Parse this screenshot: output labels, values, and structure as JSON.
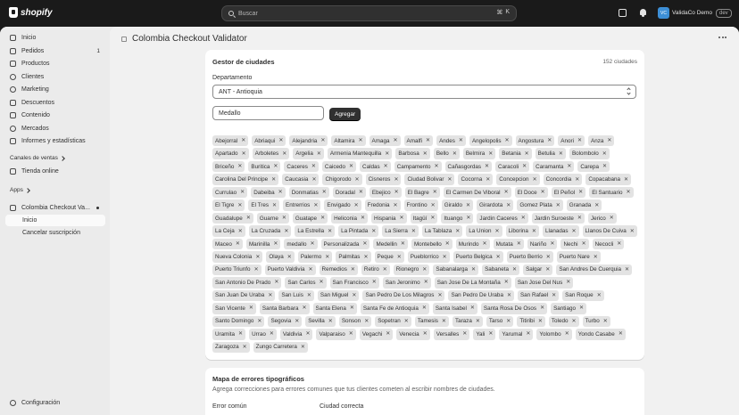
{
  "topbar": {
    "logo_text": "shopify",
    "search_placeholder": "Buscar",
    "shortcut_keys": [
      "⌘",
      "K"
    ],
    "avatar_initials": "VC",
    "store_name": "ValidaCo Demo",
    "badge": "dev"
  },
  "sidebar": {
    "items": [
      {
        "label": "Inicio",
        "icon": "home-icon"
      },
      {
        "label": "Pedidos",
        "icon": "orders-icon",
        "count": "1"
      },
      {
        "label": "Productos",
        "icon": "tag-icon"
      },
      {
        "label": "Clientes",
        "icon": "person-icon"
      },
      {
        "label": "Marketing",
        "icon": "target-icon"
      },
      {
        "label": "Descuentos",
        "icon": "discount-icon"
      },
      {
        "label": "Contenido",
        "icon": "content-icon"
      },
      {
        "label": "Mercados",
        "icon": "globe-icon"
      },
      {
        "label": "Informes y estadísticas",
        "icon": "chart-icon"
      }
    ],
    "sales_channels_label": "Canales de ventas",
    "sales_channel_item": "Tienda online",
    "apps_label": "Apps",
    "app_name": "Colombia Checkout Va...",
    "app_sub_items": [
      "Inicio",
      "Cancelar suscripción"
    ],
    "config_label": "Configuración"
  },
  "page": {
    "title": "Colombia Checkout Validator"
  },
  "cities_card": {
    "title": "Gestor de ciudades",
    "count": "152 ciudades",
    "department_label": "Departamento",
    "department_value": "ANT - Antioquia",
    "city_input_value": "Medallo",
    "add_button": "Agregar",
    "tags": [
      "Abejorral",
      "Abriaqui",
      "Alejandria",
      "Altamira",
      "Amaga",
      "Amalfi",
      "Andes",
      "Angelopolis",
      "Angostura",
      "Anori",
      "Anza",
      "Apartado",
      "Arboletes",
      "Argelia",
      "Armenia Mantequilla",
      "Barbosa",
      "Bello",
      "Belmira",
      "Betania",
      "Betulia",
      "Bolombolo",
      "Briceño",
      "Buritica",
      "Caceres",
      "Caicedo",
      "Caldas",
      "Campamento",
      "Cañasgordas",
      "Caracoli",
      "Caramanta",
      "Carepa",
      "Carolina Del Principe",
      "Caucasia",
      "Chigorodo",
      "Cisneros",
      "Ciudad Bolivar",
      "Cocorna",
      "Concepcion",
      "Concordia",
      "Copacabana",
      "Currulao",
      "Dabeiba",
      "Donmatias",
      "Doradal",
      "Ebejico",
      "El Bagre",
      "El Carmen De Viboral",
      "El Doce",
      "El Peñol",
      "El Santuario",
      "El Tigre",
      "El Tres",
      "Entrerrios",
      "Envigado",
      "Fredonia",
      "Frontino",
      "Giraldo",
      "Girardota",
      "Gomez Plata",
      "Granada",
      "Guadalupe",
      "Guarne",
      "Guatape",
      "Heliconia",
      "Hispania",
      "Itagüí",
      "Ituango",
      "Jardin Caceres",
      "Jardin Suroeste",
      "Jerico",
      "La Ceja",
      "La Cruzada",
      "La Estrella",
      "La Pintada",
      "La Sierra",
      "La Tablaza",
      "La Union",
      "Liborina",
      "Llanadas",
      "Llanos De Cuiva",
      "Maceo",
      "Marinilla",
      "medallo",
      "Personalizada",
      "Medellin",
      "Montebello",
      "Murindo",
      "Mutata",
      "Nariño",
      "Nechi",
      "Necocli",
      "Nueva Colonia",
      "Olaya",
      "Palermo",
      "Palmitas",
      "Peque",
      "Pueblorrico",
      "Puerto Belgica",
      "Puerto Berrio",
      "Puerto Nare",
      "Puerto Triunfo",
      "Puerto Valdivia",
      "Remedios",
      "Retiro",
      "Rionegro",
      "Sabanalarga",
      "Sabaneta",
      "Salgar",
      "San Andres De Cuerquia",
      "San Antonio De Prado",
      "San Carlos",
      "San Francisco",
      "San Jeronimo",
      "San Jose De La Montaña",
      "San Jose Del Nus",
      "San Juan De Uraba",
      "San Luis",
      "San Miguel",
      "San Pedro De Los Milagros",
      "San Pedro De Uraba",
      "San Rafael",
      "San Roque",
      "San Vicente",
      "Santa Barbara",
      "Santa Elena",
      "Santa Fe de Antioquia",
      "Santa Isabel",
      "Santa Rosa De Osos",
      "Santiago",
      "Santo Domingo",
      "Segovia",
      "Sevilla",
      "Sonson",
      "Sopetran",
      "Tamesis",
      "Taraza",
      "Tarso",
      "Titiribi",
      "Toledo",
      "Turbo",
      "Uramita",
      "Urrao",
      "Valdivia",
      "Valparaiso",
      "Vegachi",
      "Venecia",
      "Versalles",
      "Yali",
      "Yarumal",
      "Yolombo",
      "Yondo Casabe",
      "Zaragoza",
      "Zungo Carretera"
    ]
  },
  "errors_card": {
    "title": "Mapa de errores tipográficos",
    "subtitle": "Agrega correcciones para errores comunes que tus clientes cometen al escribir nombres de ciudades.",
    "col_error": "Error común",
    "col_correct": "Ciudad correcta"
  }
}
